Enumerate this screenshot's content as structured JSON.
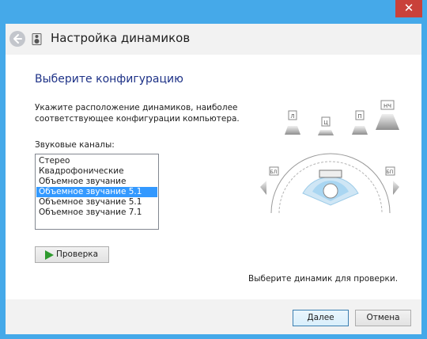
{
  "window": {
    "close_glyph": "✕"
  },
  "header": {
    "title": "Настройка динамиков",
    "back_icon": "back-arrow-icon",
    "app_icon": "speaker-icon"
  },
  "main": {
    "section_title": "Выберите конфигурацию",
    "instructions": "Укажите расположение динамиков, наиболее соответствующее конфигурации компьютера.",
    "channels_label": "Звуковые каналы:",
    "channels": [
      "Стерео",
      "Квадрофонические",
      "Объемное звучание",
      "Объемное звучание 5.1",
      "Объемное звучание 5.1",
      "Объемное звучание 7.1"
    ],
    "selected_index": 3,
    "test_button": "Проверка",
    "select_hint": "Выберите динамик для проверки."
  },
  "diagram": {
    "speakers": {
      "front_left": "Л",
      "center": "Ц",
      "front_right": "П",
      "subwoofer": "НЧ",
      "side_left": "БЛ",
      "side_right": "БП"
    }
  },
  "footer": {
    "next": "Далее",
    "cancel": "Отмена"
  },
  "colors": {
    "titlebar": "#45a9e9",
    "selection": "#3399ff",
    "heading": "#1e3287",
    "close": "#c9413a"
  }
}
